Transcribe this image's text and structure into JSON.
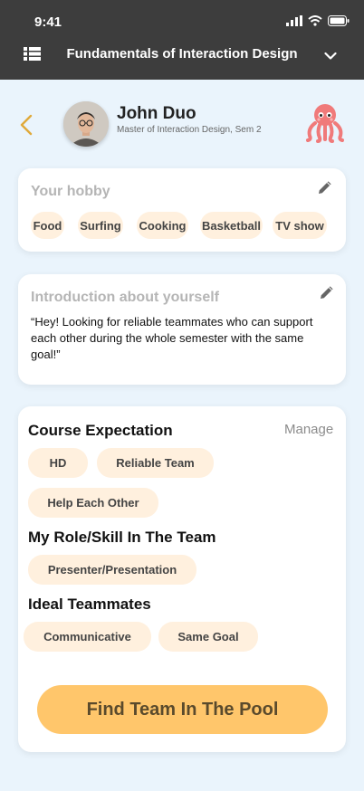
{
  "status_bar": {
    "time": "9:41"
  },
  "header": {
    "course_title": "Fundamentals of Interaction Design"
  },
  "profile": {
    "name": "John Duo",
    "subtitle": "Master of Interaction Design, Sem 2"
  },
  "hobby": {
    "title": "Your hobby",
    "chips": [
      "Food",
      "Surfing",
      "Cooking",
      "Basketball",
      "TV show"
    ]
  },
  "introduction": {
    "title": "Introduction about yourself",
    "text": "“Hey! Looking for reliable teammates who can support each other during the whole semester with the same goal!”"
  },
  "course_expectation": {
    "title": "Course Expectation",
    "manage_label": "Manage",
    "chips": [
      "HD",
      "Reliable Team",
      "Help Each Other"
    ]
  },
  "role_skill": {
    "title": "My Role/Skill In The Team",
    "chips": [
      "Presenter/Presentation"
    ]
  },
  "ideal_teammates": {
    "title": "Ideal Teammates",
    "chips": [
      "Communicative",
      "Same Goal"
    ]
  },
  "cta": {
    "label": "Find Team In The Pool"
  },
  "colors": {
    "background": "#eaf4fc",
    "header": "#3d3d3d",
    "chip": "#fff0de",
    "cta": "#ffc66b",
    "back_arrow": "#e0a93a",
    "octopus": "#f07a7a"
  }
}
